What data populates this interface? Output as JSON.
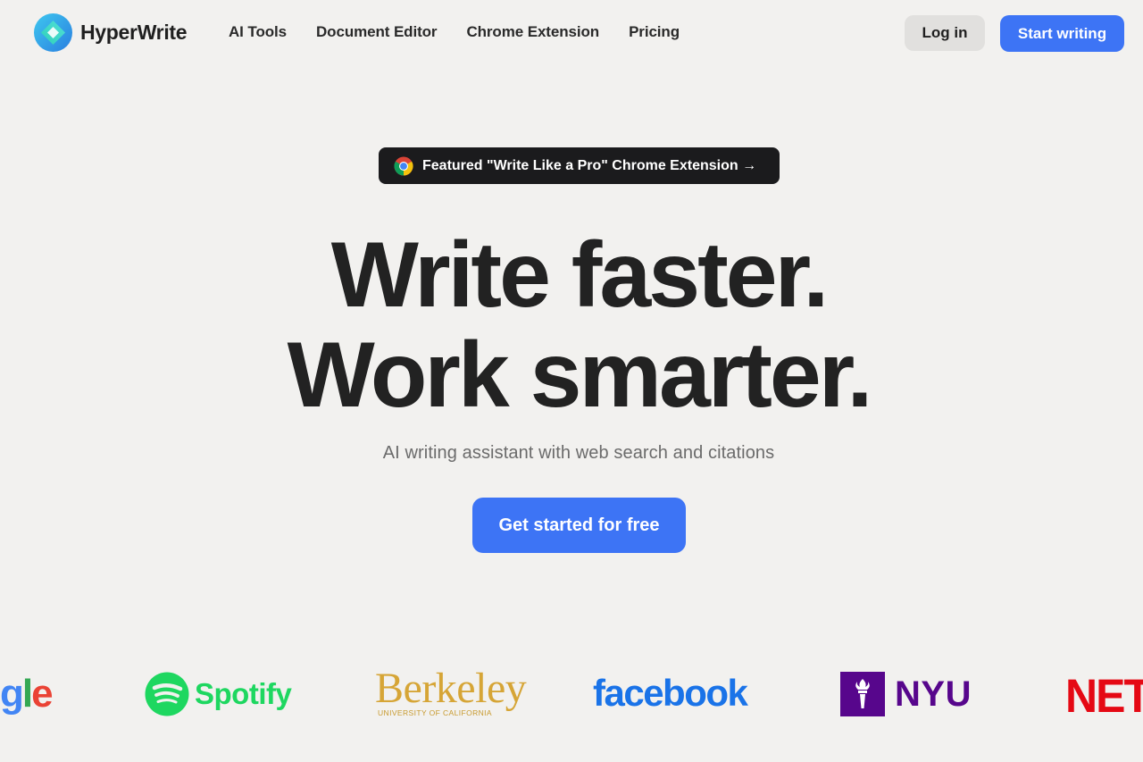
{
  "brand": {
    "name": "HyperWrite",
    "accent": "#3d74f5"
  },
  "nav": {
    "links": [
      "AI Tools",
      "Document Editor",
      "Chrome Extension",
      "Pricing"
    ],
    "login": "Log in",
    "start": "Start writing"
  },
  "badge": {
    "icon": "chrome-icon",
    "text": "Featured \"Write Like a Pro\" Chrome Extension →"
  },
  "hero": {
    "line1": "Write faster.",
    "line2": "Work smarter.",
    "subtitle": "AI writing assistant with web search and citations",
    "cta": "Get started for free"
  },
  "logos": {
    "google": "gle",
    "spotify": "Spotify",
    "berkeley": "Berkeley",
    "berkeley_sub": "UNIVERSITY OF CALIFORNIA",
    "facebook": "facebook",
    "nyu": "NYU",
    "netflix": "NETF"
  }
}
